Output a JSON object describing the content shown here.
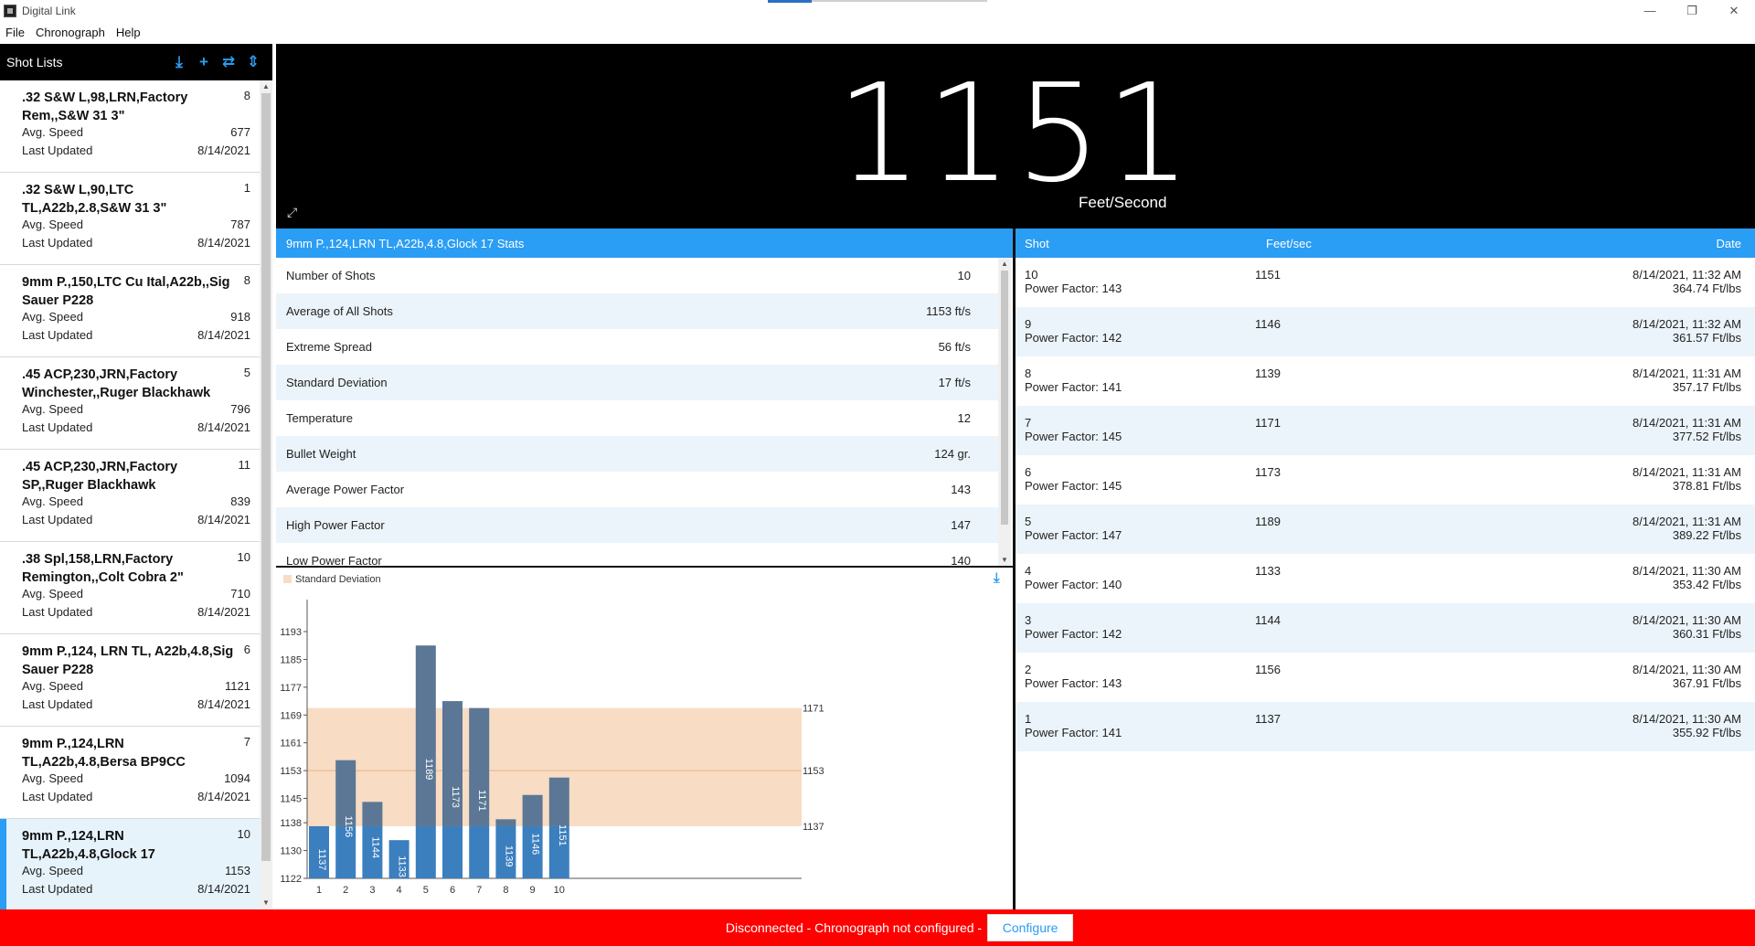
{
  "window": {
    "title": "Digital Link",
    "min": "—",
    "restore": "❐",
    "close": "✕"
  },
  "menu": [
    "File",
    "Chronograph",
    "Help"
  ],
  "sidebar": {
    "title": "Shot Lists",
    "tools": {
      "download": "⤓",
      "add": "+",
      "swap": "⇄",
      "sort": "⇕"
    },
    "avg_label": "Avg. Speed",
    "updated_label": "Last Updated",
    "items": [
      {
        "name": ".32 S&W L,98,LRN,Factory Rem,,S&W 31 3\"",
        "count": "8",
        "avg": "677",
        "updated": "8/14/2021"
      },
      {
        "name": ".32 S&W L,90,LTC TL,A22b,2.8,S&W 31 3\"",
        "count": "1",
        "avg": "787",
        "updated": "8/14/2021"
      },
      {
        "name": "9mm P.,150,LTC Cu Ital,A22b,,Sig Sauer P228",
        "count": "8",
        "avg": "918",
        "updated": "8/14/2021"
      },
      {
        "name": ".45 ACP,230,JRN,Factory Winchester,,Ruger Blackhawk",
        "count": "5",
        "avg": "796",
        "updated": "8/14/2021"
      },
      {
        "name": ".45 ACP,230,JRN,Factory SP,,Ruger Blackhawk",
        "count": "11",
        "avg": "839",
        "updated": "8/14/2021"
      },
      {
        "name": ".38 Spl,158,LRN,Factory Remington,,Colt Cobra 2\"",
        "count": "10",
        "avg": "710",
        "updated": "8/14/2021"
      },
      {
        "name": "9mm P.,124, LRN TL, A22b,4.8,Sig Sauer P228",
        "count": "6",
        "avg": "1121",
        "updated": "8/14/2021"
      },
      {
        "name": "9mm P.,124,LRN TL,A22b,4.8,Bersa BP9CC",
        "count": "7",
        "avg": "1094",
        "updated": "8/14/2021"
      },
      {
        "name": "9mm P.,124,LRN TL,A22b,4.8,Glock 17",
        "count": "10",
        "avg": "1153",
        "updated": "8/14/2021"
      }
    ]
  },
  "readout": {
    "speed": "1151",
    "unit": "Feet/Second",
    "expand": "⤢"
  },
  "stats": {
    "title": "9mm P.,124,LRN TL,A22b,4.8,Glock 17 Stats",
    "rows": [
      {
        "label": "Number of Shots",
        "value": "10"
      },
      {
        "label": "Average of All Shots",
        "value": "1153 ft/s"
      },
      {
        "label": "Extreme Spread",
        "value": "56 ft/s"
      },
      {
        "label": "Standard Deviation",
        "value": "17 ft/s"
      },
      {
        "label": "Temperature",
        "value": "12"
      },
      {
        "label": "Bullet Weight",
        "value": "124 gr."
      },
      {
        "label": "Average Power Factor",
        "value": "143"
      },
      {
        "label": "High Power Factor",
        "value": "147"
      },
      {
        "label": "Low Power Factor",
        "value": "140"
      }
    ]
  },
  "chart_data": {
    "type": "bar",
    "legend": "Standard Deviation",
    "categories": [
      "1",
      "2",
      "3",
      "4",
      "5",
      "6",
      "7",
      "8",
      "9",
      "10"
    ],
    "values": [
      1137,
      1156,
      1144,
      1133,
      1189,
      1173,
      1171,
      1139,
      1146,
      1151
    ],
    "y_ticks": [
      "1122",
      "1130",
      "1138",
      "1145",
      "1153",
      "1161",
      "1169",
      "1177",
      "1185",
      "1193"
    ],
    "ylim": [
      1122,
      1193
    ],
    "band": {
      "low": 1137,
      "mid": 1153,
      "high": 1171
    },
    "band_labels": {
      "low": "1137",
      "mid": "1153",
      "high": "1171"
    },
    "colors": {
      "bar_below": "#3b7fbf",
      "bar_above": "#5b7795",
      "band": "#f8dcc4",
      "mid_line": "#e8b48a"
    },
    "legend_placement": "top-left"
  },
  "shots": {
    "headers": {
      "shot": "Shot",
      "speed": "Feet/sec",
      "date": "Date"
    },
    "rows": [
      {
        "shot": "10",
        "pf": "Power Factor: 143",
        "speed": "1151",
        "date": "8/14/2021, 11:32 AM",
        "energy": "364.74 Ft/lbs"
      },
      {
        "shot": "9",
        "pf": "Power Factor: 142",
        "speed": "1146",
        "date": "8/14/2021, 11:32 AM",
        "energy": "361.57 Ft/lbs"
      },
      {
        "shot": "8",
        "pf": "Power Factor: 141",
        "speed": "1139",
        "date": "8/14/2021, 11:31 AM",
        "energy": "357.17 Ft/lbs"
      },
      {
        "shot": "7",
        "pf": "Power Factor: 145",
        "speed": "1171",
        "date": "8/14/2021, 11:31 AM",
        "energy": "377.52 Ft/lbs"
      },
      {
        "shot": "6",
        "pf": "Power Factor: 145",
        "speed": "1173",
        "date": "8/14/2021, 11:31 AM",
        "energy": "378.81 Ft/lbs"
      },
      {
        "shot": "5",
        "pf": "Power Factor: 147",
        "speed": "1189",
        "date": "8/14/2021, 11:31 AM",
        "energy": "389.22 Ft/lbs"
      },
      {
        "shot": "4",
        "pf": "Power Factor: 140",
        "speed": "1133",
        "date": "8/14/2021, 11:30 AM",
        "energy": "353.42 Ft/lbs"
      },
      {
        "shot": "3",
        "pf": "Power Factor: 142",
        "speed": "1144",
        "date": "8/14/2021, 11:30 AM",
        "energy": "360.31 Ft/lbs"
      },
      {
        "shot": "2",
        "pf": "Power Factor: 143",
        "speed": "1156",
        "date": "8/14/2021, 11:30 AM",
        "energy": "367.91 Ft/lbs"
      },
      {
        "shot": "1",
        "pf": "Power Factor: 141",
        "speed": "1137",
        "date": "8/14/2021, 11:30 AM",
        "energy": "355.92 Ft/lbs"
      }
    ]
  },
  "status": {
    "message": "Disconnected - Chronograph not configured -",
    "button": "Configure"
  }
}
